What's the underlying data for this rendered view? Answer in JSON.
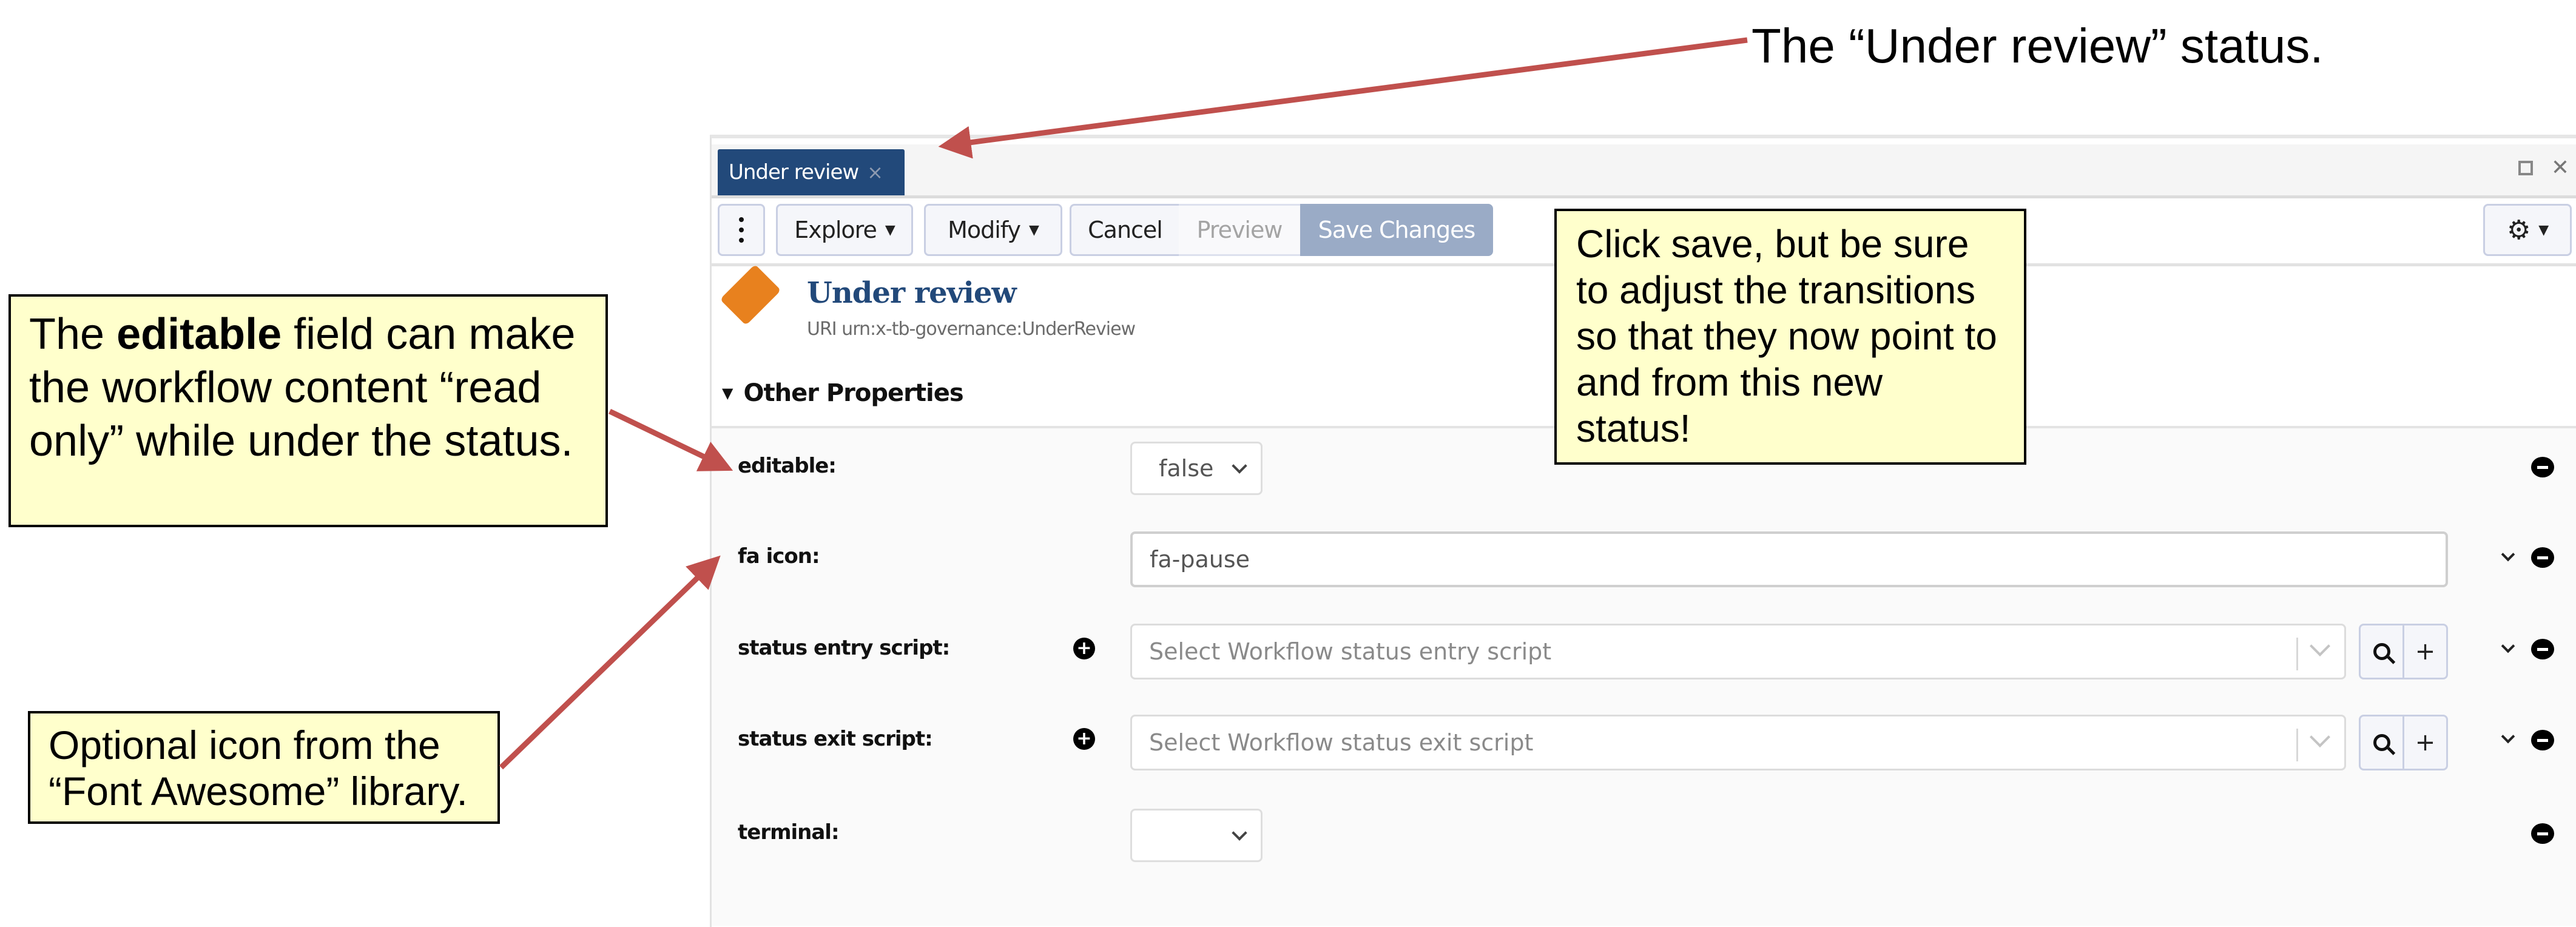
{
  "annotations": {
    "top_label": "The “Under review” status.",
    "editable_note": {
      "prefix": "The ",
      "bold": "editable",
      "suffix": " field can make the workflow content “read only” while under the status."
    },
    "icon_note": "Optional icon from the “Font Awesome” library.",
    "save_note": "Click save, but be sure to adjust the transitions so that they now point to and from this new status!",
    "arrow_color": "#c0504d",
    "callout_bg": "#ffffcc"
  },
  "tab": {
    "label": "Under review",
    "close_glyph": "×"
  },
  "window_controls": {
    "expand": "expand-icon",
    "close_glyph": "✕"
  },
  "toolbar": {
    "menu": "kebab-menu-icon",
    "explore_label": "Explore",
    "modify_label": "Modify",
    "cancel_label": "Cancel",
    "preview_label": "Preview",
    "save_label": "Save Changes",
    "settings": "gear-icon"
  },
  "header": {
    "title": "Under review",
    "uri": "URI urn:x-tb-governance:UnderReview",
    "icon_color": "#e8811e",
    "title_color": "#22497a"
  },
  "section": {
    "label": "Other Properties",
    "expanded": true
  },
  "properties": {
    "editable": {
      "label": "editable:",
      "value": "false"
    },
    "fa_icon": {
      "label": "fa icon:",
      "value": "fa-pause"
    },
    "entry_script": {
      "label": "status entry script:",
      "placeholder": "Select Workflow status entry script"
    },
    "exit_script": {
      "label": "status exit script:",
      "placeholder": "Select Workflow status exit script"
    },
    "terminal": {
      "label": "terminal:",
      "value": ""
    }
  },
  "glyphs": {
    "plus": "+",
    "caret": "▼",
    "gear": "⚙",
    "triangle_down": "▼"
  },
  "colors": {
    "tab_bg": "#22497a",
    "save_bg": "#9aabc6"
  }
}
